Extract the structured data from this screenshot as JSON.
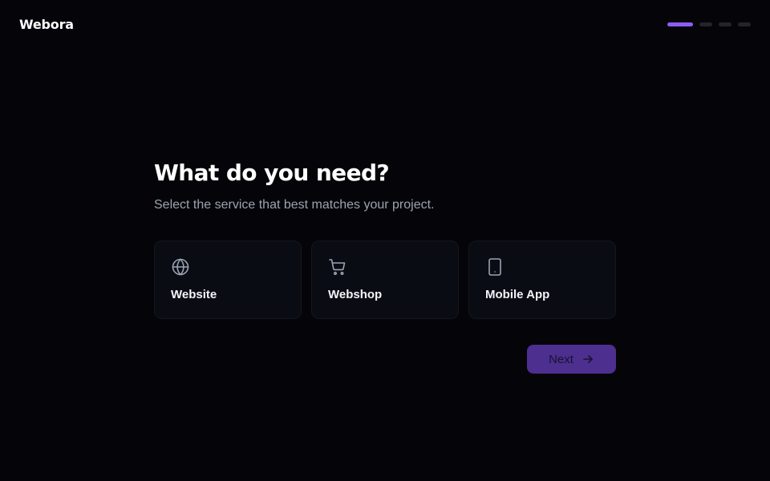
{
  "app": {
    "brand": "Webora"
  },
  "progress": {
    "total_steps": 4,
    "current_step": 1,
    "accent_color": "#8b5cf6",
    "inactive_color": "#23232b"
  },
  "step": {
    "title": "What do you need?",
    "subtitle": "Select the service that best matches your project."
  },
  "options": [
    {
      "label": "Website",
      "icon": "globe-icon"
    },
    {
      "label": "Webshop",
      "icon": "shopping-cart-icon"
    },
    {
      "label": "Mobile App",
      "icon": "smartphone-icon"
    }
  ],
  "actions": {
    "next_label": "Next",
    "next_icon": "arrow-right-icon",
    "next_color": "#4c2f8f"
  }
}
